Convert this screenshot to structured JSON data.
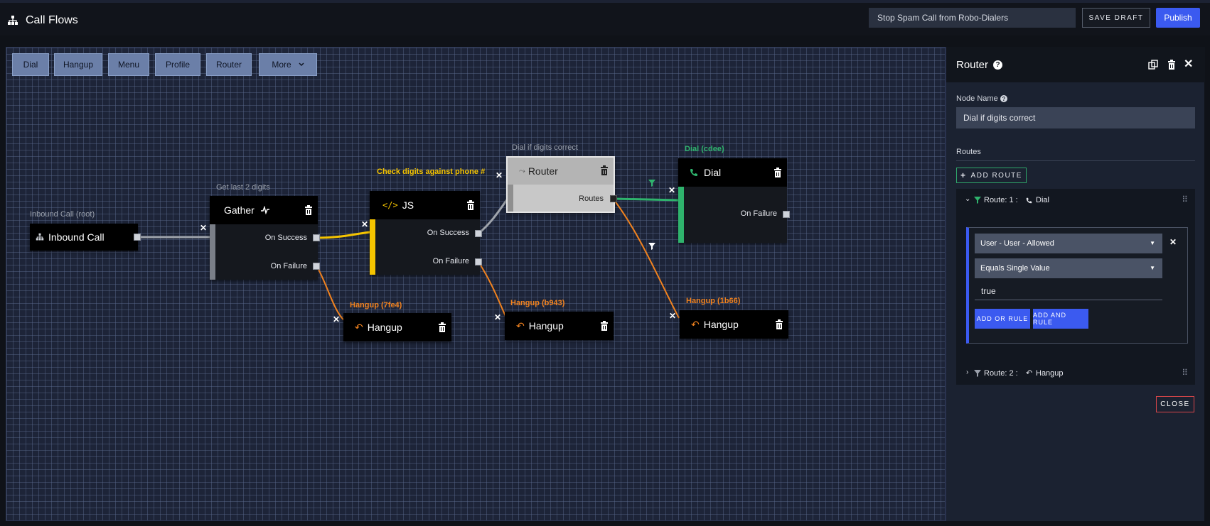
{
  "app": {
    "title": "Call Flows",
    "flow_name": "Stop Spam Call from Robo-Dialers",
    "save_draft": "SAVE DRAFT",
    "publish": "Publish"
  },
  "toolbar": {
    "items": [
      "Dial",
      "Hangup",
      "Menu",
      "Profile",
      "Router",
      "More"
    ]
  },
  "nodes": {
    "inbound": {
      "label": "Inbound Call (root)",
      "title": "Inbound Call"
    },
    "gather": {
      "label": "Get last 2 digits",
      "title": "Gather",
      "on_success": "On Success",
      "on_failure": "On Failure"
    },
    "js": {
      "label": "Check digits against phone #",
      "title": "JS",
      "on_success": "On Success",
      "on_failure": "On Failure"
    },
    "router": {
      "label": "Dial if digits correct",
      "title": "Router",
      "routes": "Routes"
    },
    "dial": {
      "label": "Dial (cdee)",
      "title": "Dial",
      "on_failure": "On Failure"
    },
    "hangup1": {
      "label": "Hangup (7fe4)",
      "title": "Hangup"
    },
    "hangup2": {
      "label": "Hangup (b943)",
      "title": "Hangup"
    },
    "hangup3": {
      "label": "Hangup (1b66)",
      "title": "Hangup"
    }
  },
  "panel": {
    "title": "Router",
    "node_name_label": "Node Name",
    "node_name_value": "Dial if digits correct",
    "routes_label": "Routes",
    "add_route": "ADD ROUTE",
    "route1": {
      "label": "Route: 1 :",
      "target": "Dial"
    },
    "rule": {
      "field": "User - User - Allowed",
      "operator": "Equals Single Value",
      "value": "true"
    },
    "add_or_rule": "ADD OR RULE",
    "add_and_rule": "ADD AND RULE",
    "route2": {
      "label": "Route: 2 :",
      "target": "Hangup"
    },
    "close": "CLOSE"
  },
  "colors": {
    "accent": "#3b5af0",
    "gather": "#7a7f88",
    "js": "#f5c400",
    "router": "#9a9a9a",
    "dial": "#2fb36d",
    "hangup": "#f0821f"
  }
}
